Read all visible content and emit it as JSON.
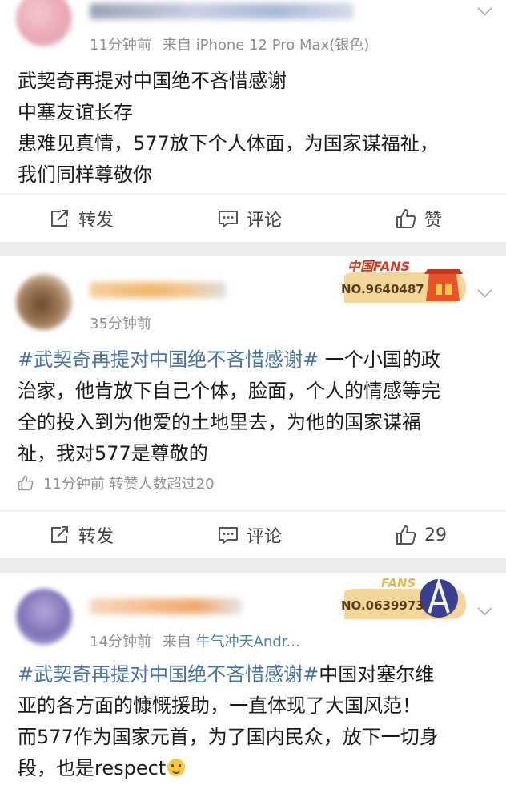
{
  "colors": {
    "link": "#4873a3",
    "meta": "#8f8f8f",
    "text": "#1a1a1a",
    "separator": "#ececec"
  },
  "posts": [
    {
      "time": "11分钟前",
      "source": "来自 iPhone 12 Pro Max(银色)",
      "body_lines": [
        "武契奇再提对中国绝不吝惜感谢",
        "中塞友谊长存",
        "患难见真情，577放下个人体面，为国家谋福祉，",
        "我们同样尊敬你"
      ],
      "actions": {
        "repost": "转发",
        "comment": "评论",
        "like": "赞"
      }
    },
    {
      "time": "35分钟前",
      "badge_title": "中国FANS",
      "badge_number": "NO.9640487",
      "hashtag": "#武契奇再提对中国绝不吝惜感谢#",
      "body_after_tag": "一个小国的政",
      "body_lines": [
        "治家，他肯放下自己个体，脸面，个人的情感等完",
        "全的投入到为他爱的土地里去，为他的国家谋福",
        "祉，我对577是尊敬的"
      ],
      "like_info": "11分钟前 转赞人数超过20",
      "actions": {
        "repost": "转发",
        "comment": "评论",
        "like": "29"
      }
    },
    {
      "time": "14分钟前",
      "source_prefix": "来自",
      "source_name": "牛气冲天Andr...",
      "badge_title": "FANS",
      "badge_number": "NO.0639973",
      "hashtag": "#武契奇再提对中国绝不吝惜感谢#",
      "body_after_tag": "中国对塞尔维",
      "body_lines": [
        "亚的各方面的慷慨援助，一直体现了大国风范！",
        "而577作为国家元首，为了国内民众，放下一切身"
      ],
      "body_last": "段，也是respect"
    }
  ]
}
